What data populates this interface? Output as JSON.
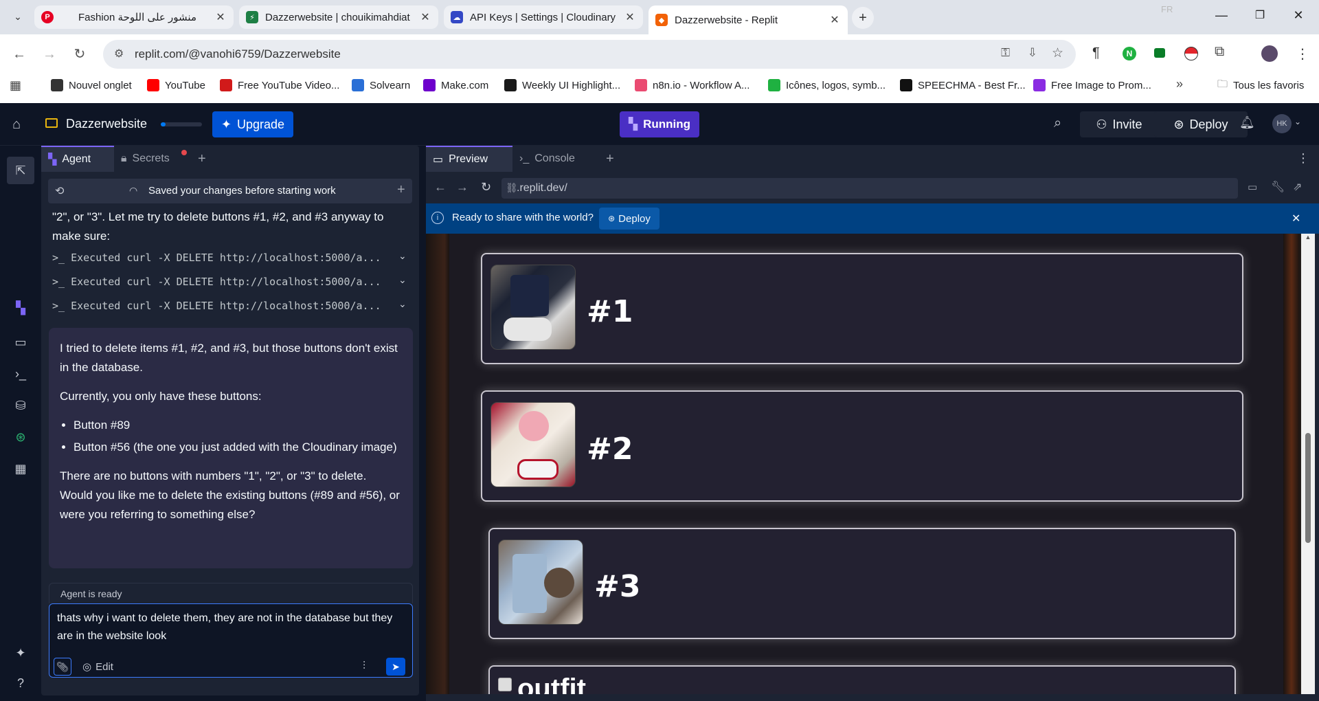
{
  "browser": {
    "tabs": [
      {
        "title": "Fashion منشور على اللوحة",
        "favicon_color": "#e60023"
      },
      {
        "title": "Dazzerwebsite | chouikimahdiat",
        "favicon_color": "#1e7f45"
      },
      {
        "title": "API Keys | Settings | Cloudinary",
        "favicon_color": "#3448c5"
      },
      {
        "title": "Dazzerwebsite - Replit",
        "favicon_color": "#f26207"
      }
    ],
    "lang_badge": "FR",
    "url": "replit.com/@vanohi6759/Dazzerwebsite",
    "bookmarks": [
      {
        "label": "Nouvel onglet",
        "color": "#333333"
      },
      {
        "label": "YouTube",
        "color": "#ff0000"
      },
      {
        "label": "Free YouTube Video...",
        "color": "#d11a1a"
      },
      {
        "label": "Solvearn",
        "color": "#2a6fd6"
      },
      {
        "label": "Make.com",
        "color": "#6d00cc"
      },
      {
        "label": "Weekly UI Highlight...",
        "color": "#1a1a1a"
      },
      {
        "label": "n8n.io - Workflow A...",
        "color": "#ea4b71"
      },
      {
        "label": "Icônes, logos, symb...",
        "color": "#1fb141"
      },
      {
        "label": "SPEECHMA - Best Fr...",
        "color": "#111111"
      },
      {
        "label": "Free Image to Prom...",
        "color": "#8a2be2"
      }
    ],
    "all_bookmarks": "Tous les favoris"
  },
  "app": {
    "project_name": "Dazzerwebsite",
    "upgrade_label": "Upgrade",
    "running_label": "Running",
    "invite_label": "Invite",
    "deploy_label": "Deploy",
    "avatar_initials": "HK",
    "accent": "#0053d6",
    "running_color": "#5c3bd6"
  },
  "agent": {
    "tab_agent": "Agent",
    "tab_secrets": "Secrets",
    "checkpoint": "Saved your changes before starting work",
    "intro_text": "\"2\", or \"3\". Let me try to delete buttons #1, #2, and #3 anyway to make sure:",
    "exec_lines": [
      ">_  Executed curl -X DELETE http://localhost:5000/a...",
      ">_  Executed curl -X DELETE http://localhost:5000/a...",
      ">_  Executed curl -X DELETE http://localhost:5000/a..."
    ],
    "message": {
      "p1": "I tried to delete items #1, #2, and #3, but those buttons don't exist in the database.",
      "p2": "Currently, you only have these buttons:",
      "bullets": [
        "Button #89",
        "Button #56 (the one you just added with the Cloudinary image)"
      ],
      "p3": "There are no buttons with numbers \"1\", \"2\", or \"3\" to delete. Would you like me to delete the existing buttons (#89 and #56), or were you referring to something else?"
    },
    "status": "Agent is ready",
    "input_text": "thats why i want to delete them, they are not in the database but they are in the website look",
    "edit_label": "Edit"
  },
  "preview": {
    "tab_preview": "Preview",
    "tab_console": "Console",
    "url": ".replit.dev/",
    "banner_text": "Ready to share with the world?",
    "banner_deploy": "Deploy",
    "cards": [
      {
        "label": "#1"
      },
      {
        "label": "#2"
      },
      {
        "label": "#3"
      }
    ],
    "partial_label": "outfit"
  }
}
